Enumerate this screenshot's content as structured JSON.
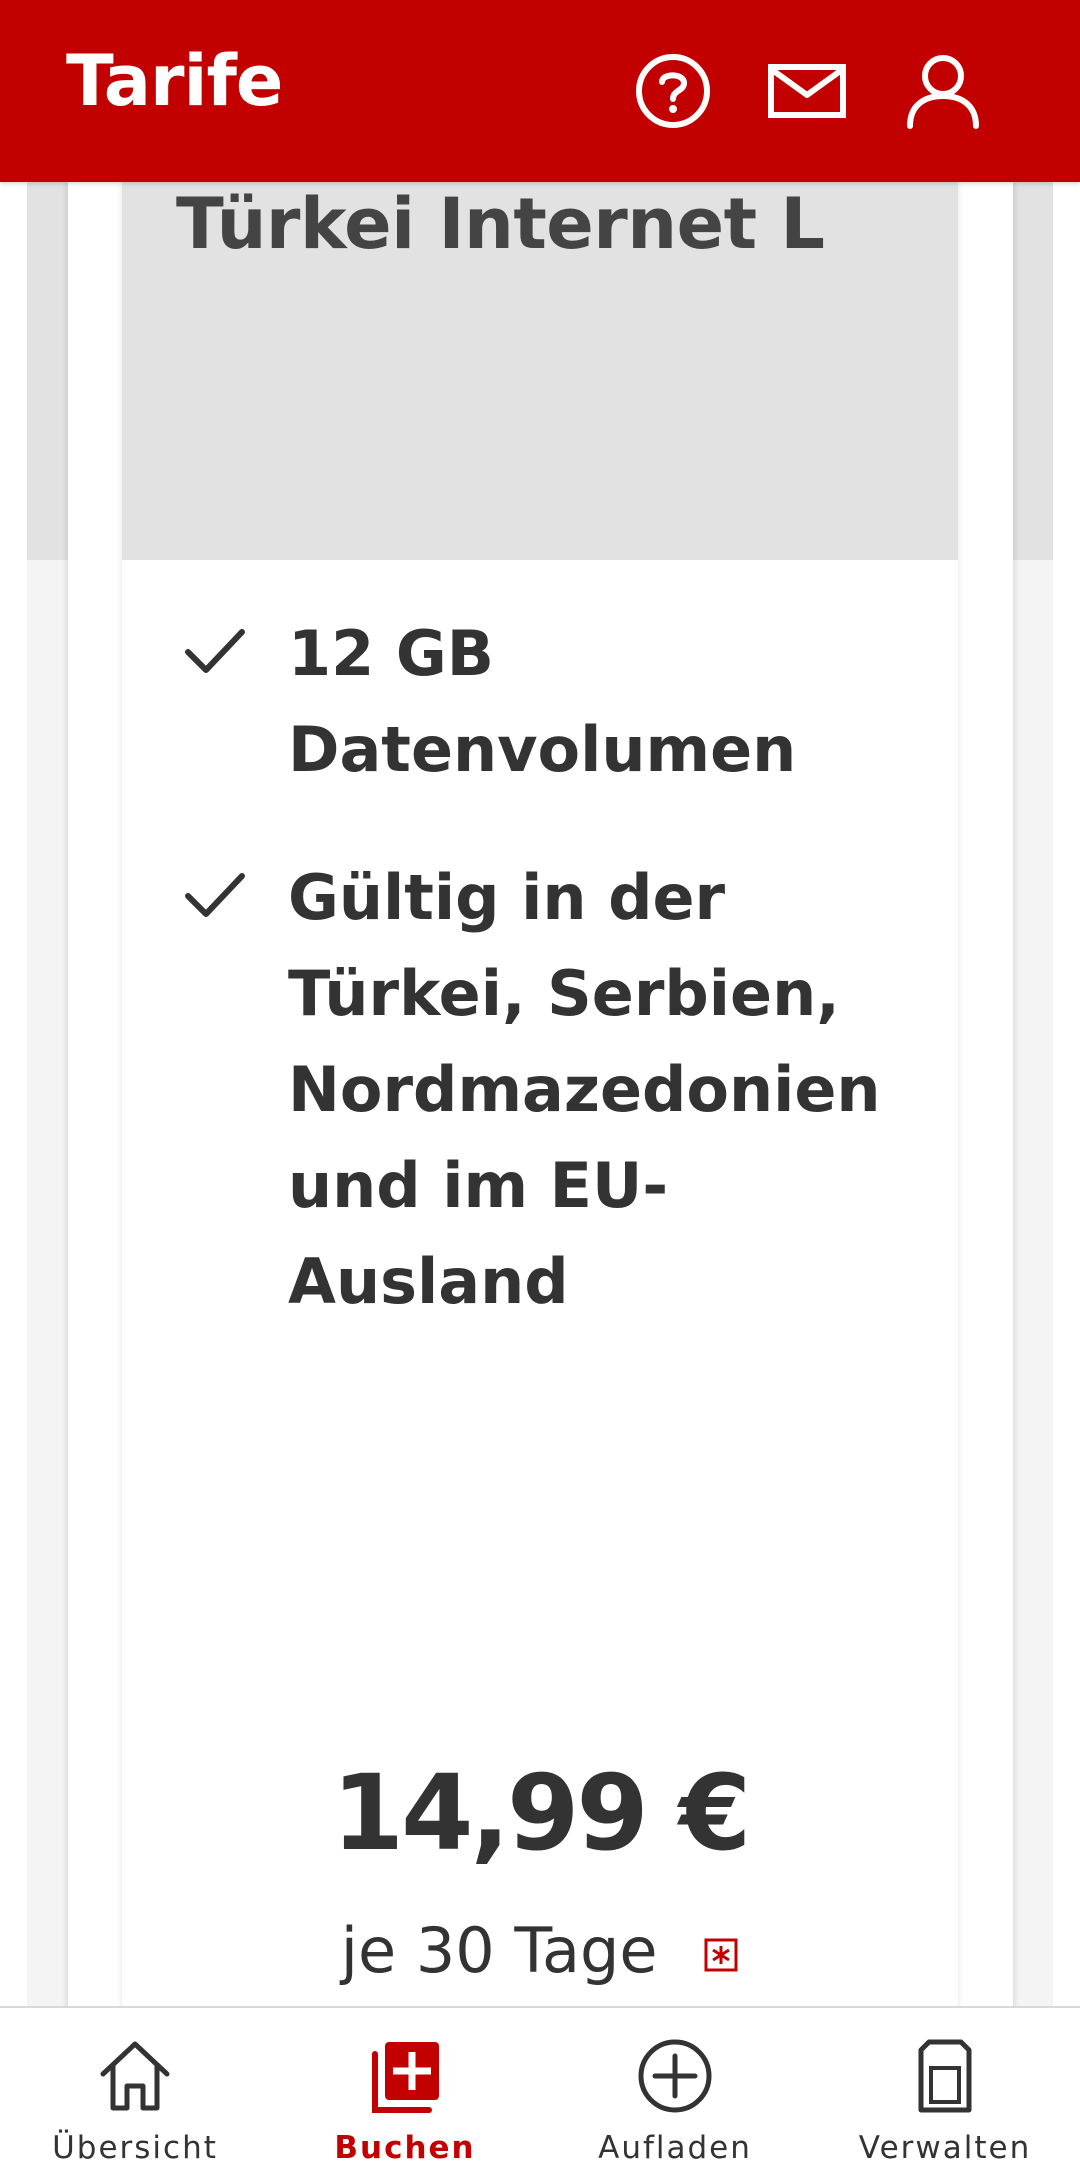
{
  "header": {
    "title": "Tarife",
    "icons": [
      "help-icon",
      "mail-icon",
      "user-icon"
    ]
  },
  "tariff": {
    "name": "Türkei Internet L",
    "features": [
      "12 GB Datenvolumen",
      "Gültig in der Türkei, Serbien, Nordmazedonien und im EU-Ausland"
    ],
    "price": "14,99 €",
    "period": "je 30 Tage"
  },
  "bottom_nav": {
    "items": [
      {
        "label": "Übersicht",
        "icon": "home-icon",
        "active": false
      },
      {
        "label": "Buchen",
        "icon": "book-plus-icon",
        "active": true
      },
      {
        "label": "Aufladen",
        "icon": "plus-circle-icon",
        "active": false
      },
      {
        "label": "Verwalten",
        "icon": "sim-card-icon",
        "active": false
      }
    ]
  },
  "colors": {
    "brand": "#c30000",
    "text": "#333333",
    "card_header_bg": "#e2e2e2"
  }
}
